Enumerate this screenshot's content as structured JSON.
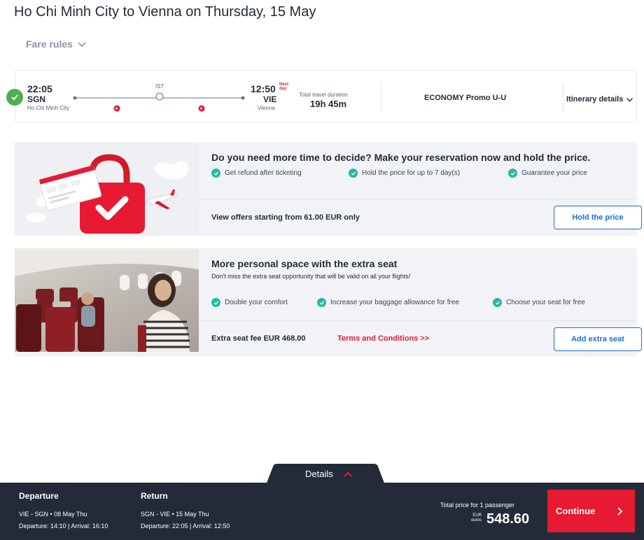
{
  "page": {
    "title": "Ho Chi Minh City to Vienna on Thursday, 15 May"
  },
  "fare_rules": {
    "label": "Fare rules"
  },
  "flight": {
    "departure_time": "22:05",
    "departure_code": "SGN",
    "departure_city": "Ho Chi Minh City",
    "stop_code": "IST",
    "arrival_time": "12:50",
    "next_day_line1": "Next",
    "next_day_line2": "day",
    "arrival_code": "VIE",
    "arrival_city": "Vienna",
    "duration_label": "Total travel duration",
    "duration_value": "19h 45m",
    "cabin": "ECONOMY Promo U-U",
    "itinerary_label": "Itinerary details"
  },
  "hold_offer": {
    "headline": "Do you need more time to decide? Make your reservation now and hold the price.",
    "features": [
      "Get refund after ticketing",
      "Hold the price for up to 7 day(s)",
      "Guarantee your price"
    ],
    "offer_text": "View offers starting from 61.00 EUR only",
    "button_label": "Hold the price"
  },
  "extra_seat": {
    "headline": "More personal space with the extra seat",
    "subtext": "Don't miss the extra seat opportunity that will be valid on all your flights!",
    "features": [
      "Double your comfort",
      "Increase your baggage allowance for free",
      "Choose your seat for free"
    ],
    "fee_text": "Extra seat fee  EUR 468.00",
    "terms_label": "Terms and Conditions >>",
    "button_label": "Add extra seat"
  },
  "details_tab": {
    "label": "Details"
  },
  "summary": {
    "departure": {
      "title": "Departure",
      "route": "VIE  -  SGN  •  08 May Thu",
      "times": "Departure: 14:10 | Arrival: 16:10"
    },
    "return": {
      "title": "Return",
      "route": "SGN  -  VIE  •  15 May Thu",
      "times": "Departure: 22:05 | Arrival: 12:50"
    },
    "total_label": "Total price for 1 passenger",
    "currency_code": "EUR",
    "currency_name": "euros",
    "price": "548.60",
    "continue_label": "Continue"
  },
  "colors": {
    "brand_red": "#e81932",
    "link_blue": "#1d6fd8",
    "check_teal": "#26b8a6",
    "confirm_green": "#4caf50",
    "dark_bar": "#232b38"
  }
}
